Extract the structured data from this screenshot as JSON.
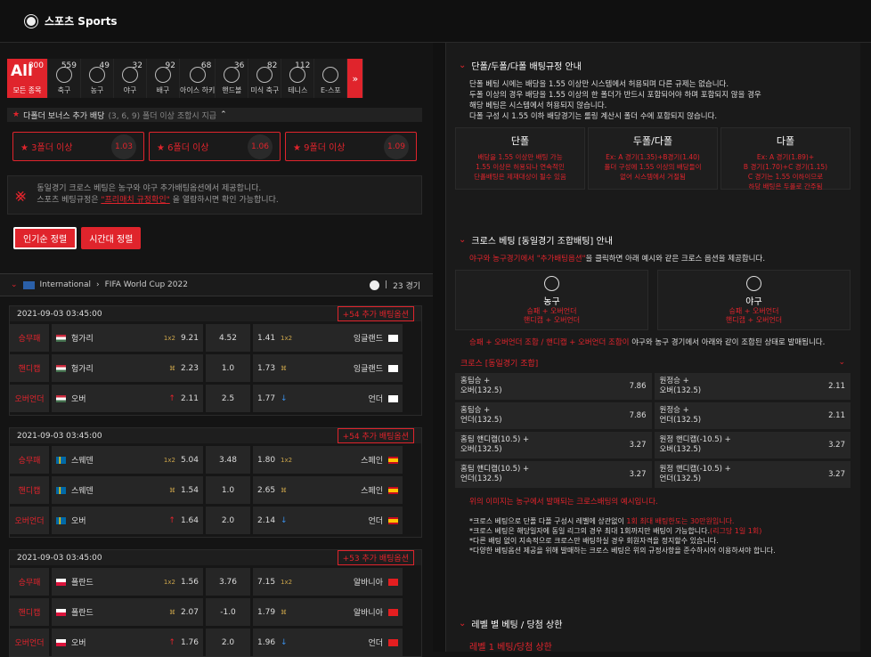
{
  "header": {
    "title": "스포츠 Sports"
  },
  "tabs": [
    {
      "label": "모든 종목",
      "count": "800",
      "big": "All"
    },
    {
      "label": "축구",
      "count": "559"
    },
    {
      "label": "농구",
      "count": "49"
    },
    {
      "label": "야구",
      "count": "32"
    },
    {
      "label": "배구",
      "count": "92"
    },
    {
      "label": "아이스 하키",
      "count": "68"
    },
    {
      "label": "핸드볼",
      "count": "36"
    },
    {
      "label": "미식 축구",
      "count": "82"
    },
    {
      "label": "테니스",
      "count": "112"
    },
    {
      "label": "E-스포",
      "count": ""
    }
  ],
  "bonus": {
    "title": "다폴더 보너스 추가 배당",
    "subtitle": "(3, 6, 9) 폴더 이상 조합시 지급",
    "items": [
      {
        "label": "3폴더 이상",
        "value": "1.03"
      },
      {
        "label": "6폴더 이상",
        "value": "1.06"
      },
      {
        "label": "9폴더 이상",
        "value": "1.09"
      }
    ]
  },
  "notice": {
    "line1": "동일경기 크로스 베팅은 농구와 야구 추가배팅옵션에서 제공합니다.",
    "line2_pre": "스포츠 베팅규정은 ",
    "line2_link": "\"프리매치 규정확인\"",
    "line2_post": " 을 열람하시면 확인 가능합니다."
  },
  "sort": {
    "popular": "인기순 정렬",
    "time": "시간대 정렬"
  },
  "league": {
    "country": "International",
    "name": "FIFA World Cup 2022",
    "count": "23 경기"
  },
  "matches": [
    {
      "date": "2021-09-03 03:45:00",
      "more": "+54 추가 배팅옵션",
      "rows": [
        {
          "type": "승무패",
          "home": "헝가리",
          "hodd": "9.21",
          "draw": "4.52",
          "aodd": "1.41",
          "away": "잉글랜드"
        },
        {
          "type": "핸디캡",
          "home": "헝가리",
          "hodd": "2.23",
          "draw": "1.0",
          "aodd": "1.73",
          "away": "잉글랜드"
        },
        {
          "type": "오버언더",
          "home": "오버",
          "hodd": "2.11",
          "draw": "2.5",
          "aodd": "1.77",
          "away": "언더"
        }
      ]
    },
    {
      "date": "2021-09-03 03:45:00",
      "more": "+54 추가 배팅옵션",
      "rows": [
        {
          "type": "승무패",
          "home": "스웨덴",
          "hodd": "5.04",
          "draw": "3.48",
          "aodd": "1.80",
          "away": "스페인"
        },
        {
          "type": "핸디캡",
          "home": "스웨덴",
          "hodd": "1.54",
          "draw": "1.0",
          "aodd": "2.65",
          "away": "스페인"
        },
        {
          "type": "오버언더",
          "home": "오버",
          "hodd": "1.64",
          "draw": "2.0",
          "aodd": "2.14",
          "away": "언더"
        }
      ]
    },
    {
      "date": "2021-09-03 03:45:00",
      "more": "+53 추가 배팅옵션",
      "rows": [
        {
          "type": "승무패",
          "home": "폴란드",
          "hodd": "1.56",
          "draw": "3.76",
          "aodd": "7.15",
          "away": "알바니아"
        },
        {
          "type": "핸디캡",
          "home": "폴란드",
          "hodd": "2.07",
          "draw": "-1.0",
          "aodd": "1.79",
          "away": "알바니아"
        },
        {
          "type": "오버언더",
          "home": "오버",
          "hodd": "1.76",
          "draw": "2.0",
          "aodd": "1.96",
          "away": "언더"
        }
      ]
    }
  ],
  "rules": {
    "title": "단폴/두폴/다폴 배팅규정 안내",
    "lines": [
      "단폴 베팅 시에는 배당을 1.55 이상만 시스템에서 허용되며 다른 규제는 없습니다.",
      "두폴 이상의 경우 배당을 1.55 이상의 한 폴더가 반드시 포함되어야 하며 포함되지 않을 경우",
      "해당 베팅은 시스템에서 허용되지 않습니다.",
      "다폴 구성 시 1.55 이하 배당경기는 롤링 계산시 폴더 수에 포함되지 않습니다."
    ],
    "cols": [
      {
        "h": "단폴",
        "l": [
          "배당을 1.55 이상만 배팅 가능",
          "",
          "1.55 이상은 허용되나 연속적인",
          "단폴배팅은 제재대상이 될수 있음"
        ]
      },
      {
        "h": "두폴/다폴",
        "l": [
          "Ex: A 경기(1.35)+B경기(1.40)",
          "",
          "폴더 구성에 1.55 이상의 배당들이",
          "없어 시스템에서 거절됨"
        ]
      },
      {
        "h": "다폴",
        "l": [
          "Ex: A 경기(1.89)+",
          "B 경기(1.70)+C 경기(1.15)",
          "C 경기는 1.55 이하이므로",
          "하당 배팅은 두폴로 간주됨"
        ]
      }
    ]
  },
  "cross": {
    "title": "크로스 베팅 [동일경기 조합배팅] 안내",
    "intro_pre": "야구와 농구경기에서 ",
    "intro_red": "\"추가배팅옵션\"",
    "intro_post": "을 클릭하면 아래 예시와 같은 크로스 옵션을 제공합니다.",
    "sports": [
      {
        "h": "농구",
        "l1": "승패 + 오버언더",
        "l2": "핸디캡 + 오버언더"
      },
      {
        "h": "야구",
        "l1": "승패 + 오버언더",
        "l2": "핸디캡 + 오버언더"
      }
    ],
    "combo_red": "승패 + 오버언더 조합 / 핸디캡 + 오버언더 조합이",
    "combo_post": " 야구와 농구 경기에서 아래와 같이 조합된 상태로 발매됩니다.",
    "bar": "크로스 [동일경기 조합]",
    "grid": [
      {
        "a": "홈팀승 +",
        "b": "오버(132.5)",
        "v": "7.86"
      },
      {
        "a": "원정승 +",
        "b": "오버(132.5)",
        "v": "2.11"
      },
      {
        "a": "홈팀승 +",
        "b": "언더(132.5)",
        "v": "7.86"
      },
      {
        "a": "원정승 +",
        "b": "언더(132.5)",
        "v": "2.11"
      },
      {
        "a": "홈팀 핸디캡(10.5) +",
        "b": "오버(132.5)",
        "v": "3.27"
      },
      {
        "a": "원정 핸디캡(-10.5) +",
        "b": "오버(132.5)",
        "v": "3.27"
      },
      {
        "a": "홈팀 핸디캡(10.5) +",
        "b": "언더(132.5)",
        "v": "3.27"
      },
      {
        "a": "원정 핸디캡(-10.5) +",
        "b": "언더(132.5)",
        "v": "3.27"
      }
    ],
    "example": "위의 이미지는 농구에서 발매되는 크로스배팅의 예시입니다.",
    "notes": [
      {
        "pre": "*크로스 베팅으로 단폴 다폴 구성시 레벨에 상관없이 ",
        "red": "1회 최대 배팅한도는 30만원입니다.",
        "post": ""
      },
      {
        "pre": "*크로스 베팅은 해당일자에 동일 리그의 경우 최대 1회까지만 배팅이 가능합니다.",
        "red": "(리그당 1일 1회)",
        "post": ""
      },
      {
        "pre": "*다른 배팅 없이 지속적으로 크로스만 배팅하실 경우 회원자격을 정지할수 있습니다.",
        "red": "",
        "post": ""
      },
      {
        "pre": "*다양한 베팅옵션 제공을 위해 발매하는 크로스 베팅은 위의 규정사항을 준수하시어 이용하셔야 합니다.",
        "red": "",
        "post": ""
      }
    ]
  },
  "limit": {
    "title": "레벨 별 베팅 / 당첨 상한",
    "sub": "레벨 1 베팅/당첨 상한"
  }
}
